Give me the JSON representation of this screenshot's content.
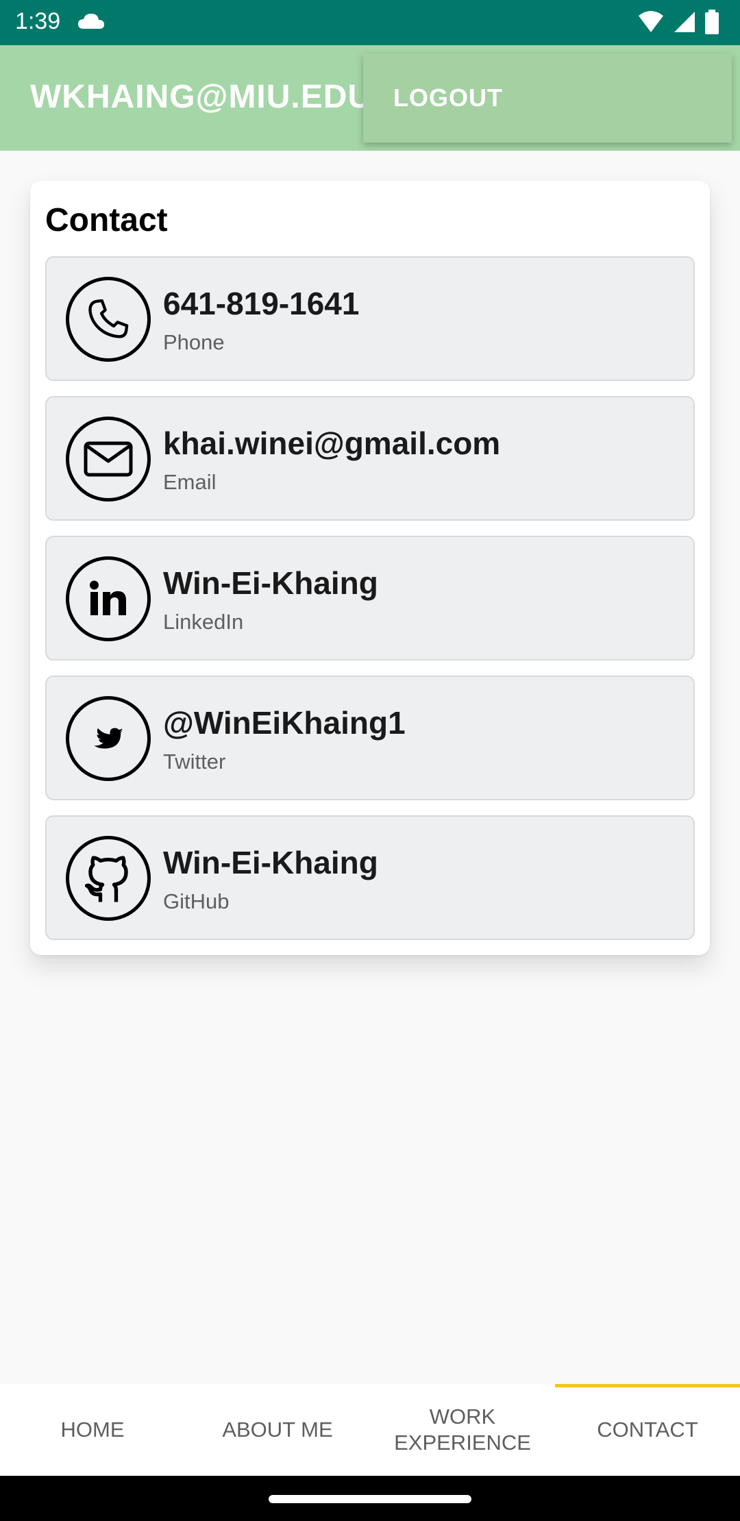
{
  "status": {
    "time": "1:39"
  },
  "app_bar": {
    "title": "WKHAING@MIU.EDU(S"
  },
  "menu": {
    "logout": "LOGOUT"
  },
  "card": {
    "title": "Contact",
    "items": [
      {
        "value": "641-819-1641",
        "label": "Phone",
        "icon": "phone-icon"
      },
      {
        "value": "khai.winei@gmail.com",
        "label": "Email",
        "icon": "email-icon"
      },
      {
        "value": "Win-Ei-Khaing",
        "label": "LinkedIn",
        "icon": "linkedin-icon"
      },
      {
        "value": "@WinEiKhaing1",
        "label": "Twitter",
        "icon": "twitter-icon"
      },
      {
        "value": "Win-Ei-Khaing",
        "label": "GitHub",
        "icon": "github-icon"
      }
    ]
  },
  "nav": {
    "tabs": [
      {
        "label": "HOME"
      },
      {
        "label": "ABOUT ME"
      },
      {
        "label": "WORK EXPERIENCE"
      },
      {
        "label": "CONTACT",
        "selected": true
      }
    ],
    "indicator_color": "#f5c518"
  },
  "colors": {
    "status_bar": "#00796b",
    "app_bar": "#a5d6a7",
    "row_background": "#eeeff1"
  }
}
